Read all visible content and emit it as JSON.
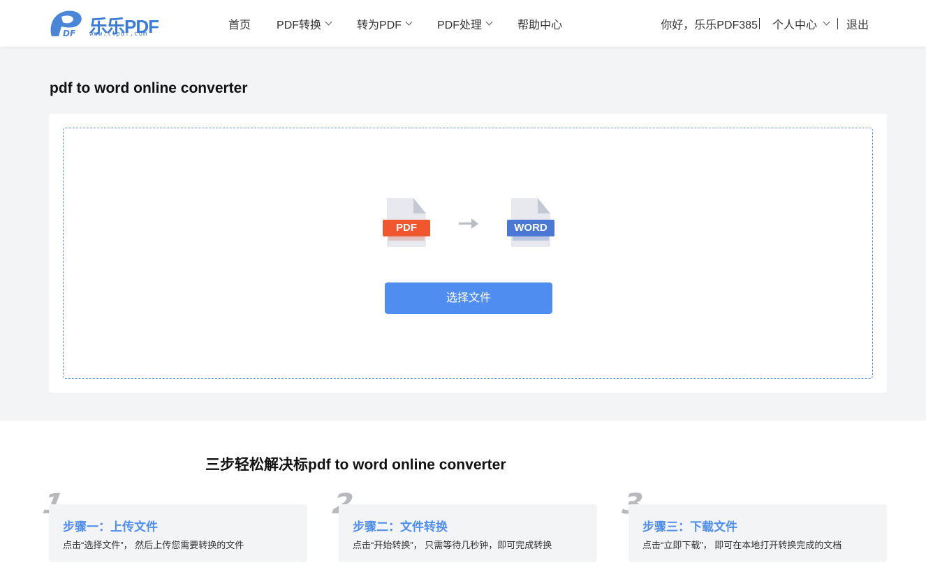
{
  "header": {
    "logo_text": "乐乐PDF",
    "logo_url": "www.llpdf.com",
    "nav": [
      {
        "label": "首页",
        "has_dropdown": false
      },
      {
        "label": "PDF转换",
        "has_dropdown": true
      },
      {
        "label": "转为PDF",
        "has_dropdown": true
      },
      {
        "label": "PDF处理",
        "has_dropdown": true
      },
      {
        "label": "帮助中心",
        "has_dropdown": false
      }
    ],
    "greeting": "你好，乐乐PDF385",
    "user_center": "个人中心",
    "logout": "退出"
  },
  "main": {
    "title": "pdf to word online converter",
    "source_label": "PDF",
    "target_label": "WORD",
    "choose_button": "选择文件"
  },
  "steps": {
    "title": "三步轻松解决标pdf to word online converter",
    "items": [
      {
        "num": "1",
        "title": "步骤一：上传文件",
        "desc": "点击“选择文件”， 然后上传您需要转换的文件"
      },
      {
        "num": "2",
        "title": "步骤二：文件转换",
        "desc": "点击“开始转换”， 只需等待几秒钟，即可完成转换"
      },
      {
        "num": "3",
        "title": "步骤三：下载文件",
        "desc": "点击“立即下载”， 即可在本地打开转换完成的文档"
      }
    ]
  },
  "colors": {
    "accent": "#4f8ef0",
    "pdf_red": "#f0572f",
    "word_blue": "#4a78d4",
    "band_gray": "#f3f4f6"
  }
}
